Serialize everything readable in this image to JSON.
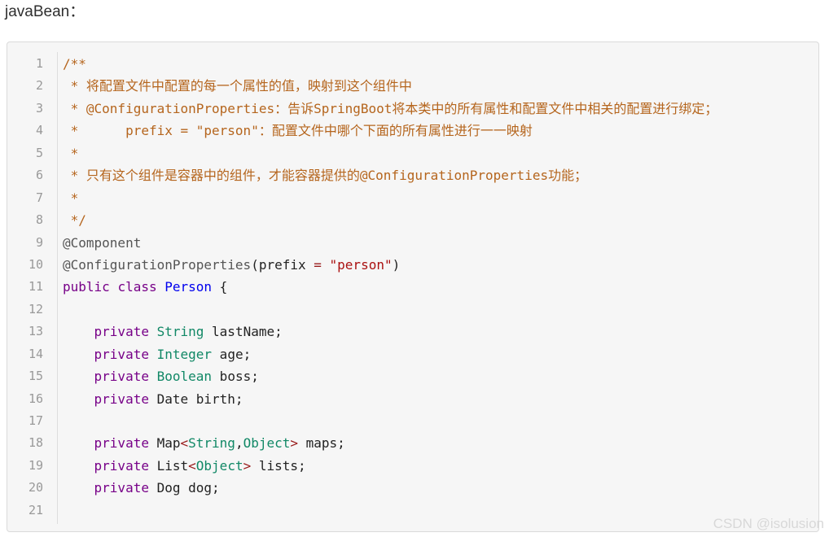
{
  "intro_text": "javaBean：",
  "watermark": "CSDN @isolusion",
  "code": {
    "language": "java",
    "lines": [
      {
        "n": "1",
        "tokens": [
          {
            "t": "comment",
            "v": "/**"
          }
        ]
      },
      {
        "n": "2",
        "tokens": [
          {
            "t": "comment",
            "v": " * 将配置文件中配置的每一个属性的值，映射到这个组件中"
          }
        ]
      },
      {
        "n": "3",
        "tokens": [
          {
            "t": "comment",
            "v": " * @ConfigurationProperties：告诉SpringBoot将本类中的所有属性和配置文件中相关的配置进行绑定；"
          }
        ]
      },
      {
        "n": "4",
        "tokens": [
          {
            "t": "comment",
            "v": " *      prefix = \"person\"：配置文件中哪个下面的所有属性进行一一映射"
          }
        ]
      },
      {
        "n": "5",
        "tokens": [
          {
            "t": "comment",
            "v": " *"
          }
        ]
      },
      {
        "n": "6",
        "tokens": [
          {
            "t": "comment",
            "v": " * 只有这个组件是容器中的组件，才能容器提供的@ConfigurationProperties功能；"
          }
        ]
      },
      {
        "n": "7",
        "tokens": [
          {
            "t": "comment",
            "v": " *"
          }
        ]
      },
      {
        "n": "8",
        "tokens": [
          {
            "t": "comment",
            "v": " */"
          }
        ]
      },
      {
        "n": "9",
        "tokens": [
          {
            "t": "annotation",
            "v": "@Component"
          }
        ]
      },
      {
        "n": "10",
        "tokens": [
          {
            "t": "annotation",
            "v": "@ConfigurationProperties"
          },
          {
            "t": "plain",
            "v": "(prefix "
          },
          {
            "t": "op",
            "v": "="
          },
          {
            "t": "plain",
            "v": " "
          },
          {
            "t": "string",
            "v": "\"person\""
          },
          {
            "t": "plain",
            "v": ")"
          }
        ]
      },
      {
        "n": "11",
        "tokens": [
          {
            "t": "keyword",
            "v": "public"
          },
          {
            "t": "plain",
            "v": " "
          },
          {
            "t": "keyword",
            "v": "class"
          },
          {
            "t": "plain",
            "v": " "
          },
          {
            "t": "class-name",
            "v": "Person"
          },
          {
            "t": "plain",
            "v": " {"
          }
        ]
      },
      {
        "n": "12",
        "tokens": []
      },
      {
        "n": "13",
        "tokens": [
          {
            "t": "plain",
            "v": "    "
          },
          {
            "t": "keyword",
            "v": "private"
          },
          {
            "t": "plain",
            "v": " "
          },
          {
            "t": "type",
            "v": "String"
          },
          {
            "t": "plain",
            "v": " lastName;"
          }
        ]
      },
      {
        "n": "14",
        "tokens": [
          {
            "t": "plain",
            "v": "    "
          },
          {
            "t": "keyword",
            "v": "private"
          },
          {
            "t": "plain",
            "v": " "
          },
          {
            "t": "type",
            "v": "Integer"
          },
          {
            "t": "plain",
            "v": " age;"
          }
        ]
      },
      {
        "n": "15",
        "tokens": [
          {
            "t": "plain",
            "v": "    "
          },
          {
            "t": "keyword",
            "v": "private"
          },
          {
            "t": "plain",
            "v": " "
          },
          {
            "t": "type",
            "v": "Boolean"
          },
          {
            "t": "plain",
            "v": " boss;"
          }
        ]
      },
      {
        "n": "16",
        "tokens": [
          {
            "t": "plain",
            "v": "    "
          },
          {
            "t": "keyword",
            "v": "private"
          },
          {
            "t": "plain",
            "v": " Date birth;"
          }
        ]
      },
      {
        "n": "17",
        "tokens": []
      },
      {
        "n": "18",
        "tokens": [
          {
            "t": "plain",
            "v": "    "
          },
          {
            "t": "keyword",
            "v": "private"
          },
          {
            "t": "plain",
            "v": " Map"
          },
          {
            "t": "op",
            "v": "<"
          },
          {
            "t": "type",
            "v": "String"
          },
          {
            "t": "plain",
            "v": ","
          },
          {
            "t": "type",
            "v": "Object"
          },
          {
            "t": "op",
            "v": ">"
          },
          {
            "t": "plain",
            "v": " maps;"
          }
        ]
      },
      {
        "n": "19",
        "tokens": [
          {
            "t": "plain",
            "v": "    "
          },
          {
            "t": "keyword",
            "v": "private"
          },
          {
            "t": "plain",
            "v": " List"
          },
          {
            "t": "op",
            "v": "<"
          },
          {
            "t": "type",
            "v": "Object"
          },
          {
            "t": "op",
            "v": ">"
          },
          {
            "t": "plain",
            "v": " lists;"
          }
        ]
      },
      {
        "n": "20",
        "tokens": [
          {
            "t": "plain",
            "v": "    "
          },
          {
            "t": "keyword",
            "v": "private"
          },
          {
            "t": "plain",
            "v": " Dog dog;"
          }
        ]
      },
      {
        "n": "21",
        "tokens": []
      }
    ]
  },
  "colors": {
    "comment": "#b5651d",
    "annotation": "#555555",
    "keyword": "#770088",
    "type": "#118866",
    "class_name": "#0000ee",
    "string": "#aa1111",
    "background": "#f6f6f6"
  }
}
